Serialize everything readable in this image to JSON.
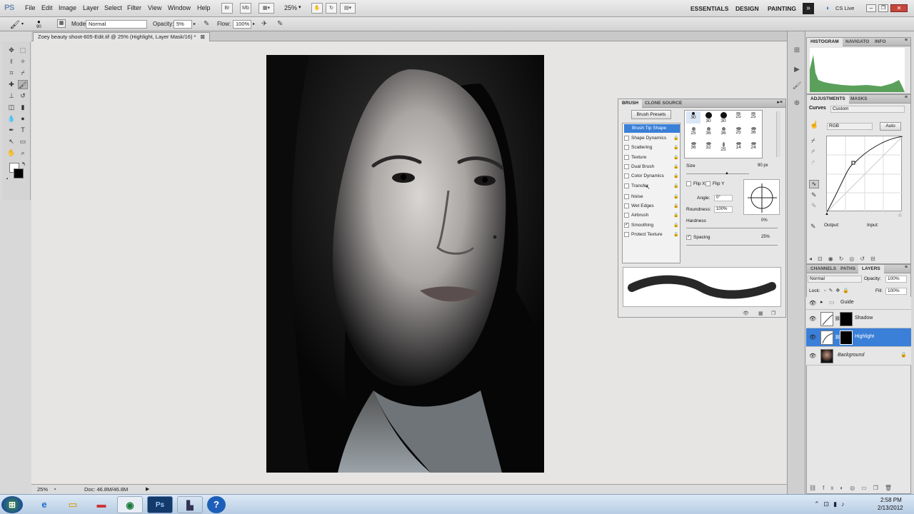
{
  "app": {
    "logo": "PS"
  },
  "menu": [
    "File",
    "Edit",
    "Image",
    "Layer",
    "Select",
    "Filter",
    "View",
    "Window",
    "Help"
  ],
  "appbar": {
    "br": "Br",
    "mb": "Mb",
    "zoom": "25%"
  },
  "workspaces": [
    "ESSENTIALS",
    "DESIGN",
    "PAINTING"
  ],
  "cslive": "CS Live",
  "options": {
    "brush_size": "90",
    "mode_label": "Mode:",
    "mode_value": "Normal",
    "opacity_label": "Opacity:",
    "opacity_value": "5%",
    "flow_label": "Flow:",
    "flow_value": "100%"
  },
  "document": {
    "tab_title": "Zoey beauty shoot-605-Edit.tif @ 25% (Highlight, Layer Mask/16) *"
  },
  "status": {
    "zoom": "25%",
    "doc": "Doc: 46.8M/46.8M"
  },
  "brush_panel": {
    "tabs": [
      "BRUSH",
      "CLONE SOURCE"
    ],
    "presets_button": "Brush Presets",
    "options": [
      {
        "label": "Brush Tip Shape",
        "checked": false
      },
      {
        "label": "Shape Dynamics",
        "checked": false
      },
      {
        "label": "Scattering",
        "checked": false
      },
      {
        "label": "Texture",
        "checked": false
      },
      {
        "label": "Dual Brush",
        "checked": false
      },
      {
        "label": "Color Dynamics",
        "checked": false
      },
      {
        "label": "Transfer",
        "checked": false
      },
      {
        "label": "Noise",
        "checked": false
      },
      {
        "label": "Wet Edges",
        "checked": false
      },
      {
        "label": "Airbrush",
        "checked": false
      },
      {
        "label": "Smoothing",
        "checked": true
      },
      {
        "label": "Protect Texture",
        "checked": false
      }
    ],
    "tip_sizes": [
      "30",
      "30",
      "30",
      "25",
      "25",
      "25",
      "36",
      "36",
      "25",
      "36",
      "36",
      "32",
      "25",
      "14",
      "24"
    ],
    "size_label": "Size",
    "size_value": "90 px",
    "flip_x": "Flip X",
    "flip_y": "Flip Y",
    "angle_label": "Angle:",
    "angle_value": "0°",
    "roundness_label": "Roundness:",
    "roundness_value": "100%",
    "hardness_label": "Hardness",
    "hardness_value": "0%",
    "spacing_label": "Spacing",
    "spacing_value": "25%"
  },
  "histogram_panel": {
    "tabs": [
      "HISTOGRAM",
      "NAVIGATO",
      "INFO"
    ]
  },
  "adjustments_panel": {
    "tabs": [
      "ADJUSTMENTS",
      "MASKS"
    ],
    "type": "Curves",
    "preset": "Custom",
    "channel": "RGB",
    "auto": "Auto",
    "output_label": "Output:",
    "input_label": "Input:"
  },
  "layers_panel": {
    "tabs": [
      "CHANNELS",
      "PATHS",
      "LAYERS"
    ],
    "blend": "Normal",
    "opacity_label": "Opacity:",
    "opacity_value": "100%",
    "lock_label": "Lock:",
    "fill_label": "Fill:",
    "fill_value": "100%",
    "layers": [
      {
        "name": "Guide"
      },
      {
        "name": "Shadow"
      },
      {
        "name": "Highlight"
      },
      {
        "name": "Background"
      }
    ]
  },
  "taskbar": {
    "time": "2:58 PM",
    "date": "2/13/2012"
  }
}
